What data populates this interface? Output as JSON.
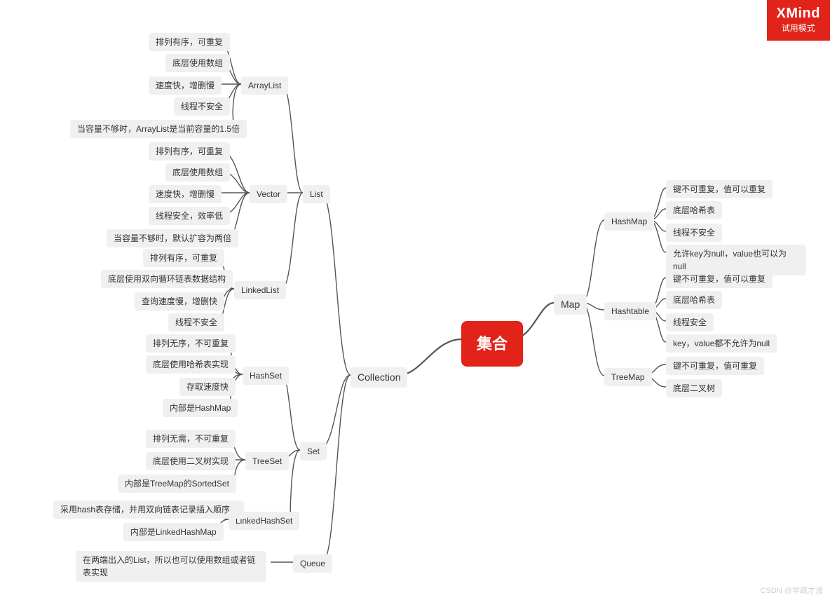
{
  "watermark": {
    "brand": "XMind",
    "mode": "试用模式"
  },
  "credit": "CSDN @学疏才浅",
  "root": "集合",
  "collection": "Collection",
  "map": "Map",
  "list": "List",
  "set": "Set",
  "queue": "Queue",
  "arraylist": "ArrayList",
  "vector": "Vector",
  "linkedlist": "LinkedList",
  "hashset": "HashSet",
  "treeset": "TreeSet",
  "linkedhashset": "LinkedHashSet",
  "hashmap": "HashMap",
  "hashtable": "Hashtable",
  "treemap": "TreeMap",
  "al": {
    "a": "排列有序，可重复",
    "b": "底层使用数组",
    "c": "速度快，增删慢",
    "d": "线程不安全",
    "e": "当容量不够时，ArrayList是当前容量的1.5倍"
  },
  "vec": {
    "a": "排列有序，可重复",
    "b": "底层使用数组",
    "c": "速度快，增删慢",
    "d": "线程安全，效率低",
    "e": "当容量不够时，默认扩容为两倍"
  },
  "ll": {
    "a": "排列有序，可重复",
    "b": "底层使用双向循环链表数据结构",
    "c": "查询速度慢，增删快",
    "d": "线程不安全"
  },
  "hs": {
    "a": "排列无序，不可重复",
    "b": "底层使用哈希表实现",
    "c": "存取速度快",
    "d": "内部是HashMap"
  },
  "ts": {
    "a": "排列无需，不可重复",
    "b": "底层使用二叉树实现",
    "c": "内部是TreeMap的SortedSet"
  },
  "lhs": {
    "a": "采用hash表存储，并用双向链表记录插入顺序",
    "b": "内部是LinkedHashMap"
  },
  "q": "在两端出入的List，所以也可以使用数组或者链表实现",
  "hm": {
    "a": "键不可重复，值可以重复",
    "b": "底层哈希表",
    "c": "线程不安全",
    "d": "允许key为null，value也可以为null"
  },
  "ht": {
    "a": "键不可重复，值可以重复",
    "b": "底层哈希表",
    "c": "线程安全",
    "d": "key，value都不允许为null"
  },
  "tm": {
    "a": "键不可重复，值可重复",
    "b": "底层二叉树"
  }
}
